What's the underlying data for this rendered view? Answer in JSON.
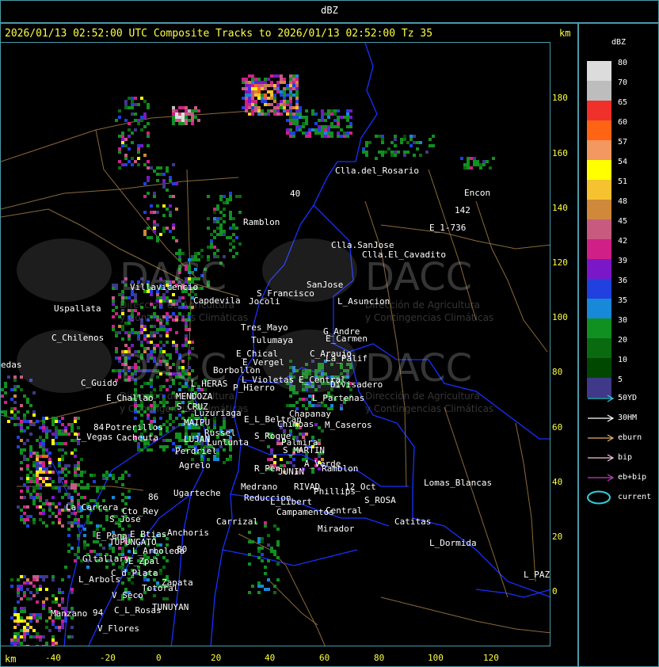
{
  "top_title": "dBZ",
  "header": "2026/01/13 02:52:00 UTC Composite Tracks to 2026/01/13 02:52:00 Tz 35",
  "km_unit": "km",
  "y_ticks": [
    "180",
    "160",
    "140",
    "120",
    "100",
    "80",
    "60",
    "40",
    "20",
    "0"
  ],
  "x_ticks": [
    "-40",
    "-20",
    "0",
    "20",
    "40",
    "60",
    "80",
    "100",
    "120"
  ],
  "legend": {
    "title": "dBZ",
    "levels": [
      {
        "value": "80",
        "color": "#dcdcdc"
      },
      {
        "value": "70",
        "color": "#bdbdbd"
      },
      {
        "value": "65",
        "color": "#f0302a"
      },
      {
        "value": "60",
        "color": "#ff6414"
      },
      {
        "value": "57",
        "color": "#f29860"
      },
      {
        "value": "54",
        "color": "#ffff00"
      },
      {
        "value": "51",
        "color": "#f6c230"
      },
      {
        "value": "48",
        "color": "#d0883a"
      },
      {
        "value": "45",
        "color": "#c85a80"
      },
      {
        "value": "42",
        "color": "#d02088"
      },
      {
        "value": "39",
        "color": "#7a18c8"
      },
      {
        "value": "36",
        "color": "#2040e0"
      },
      {
        "value": "35",
        "color": "#1888d8"
      },
      {
        "value": "30",
        "color": "#109020"
      },
      {
        "value": "20",
        "color": "#0a6a10"
      },
      {
        "value": "10",
        "color": "#004800"
      },
      {
        "value": "5",
        "color": "#403888"
      }
    ],
    "tracks": [
      {
        "label": "50YD",
        "color": "#30d0e0"
      },
      {
        "label": "30HM",
        "color": "#ffffff"
      },
      {
        "label": "eburn",
        "color": "#e0b070"
      },
      {
        "label": "bip",
        "color": "#f0c8e0"
      },
      {
        "label": "eb+bip",
        "color": "#c040c0"
      }
    ],
    "current_label": "current",
    "current_color": "#30d0e0"
  },
  "watermark": {
    "brand": "DACC",
    "line1": "Dirección de Agricultura",
    "line2": "y Contingencias Climáticas"
  },
  "places": [
    "Clla.del_Rosario",
    "Encon",
    "142",
    "E_1-736",
    "Ramblon",
    "Clla.SanJose",
    "Clla.El_Cavadito",
    "S_Francisco",
    "SanJose",
    "L_Asuncion",
    "Villavicencio",
    "Capdevila",
    "Jocoli",
    "Uspallata",
    "Tres_Mayo",
    "Tulumaya",
    "C_Chilenos",
    "G_Andre",
    "E_Carmen",
    "E_Chical",
    "E_Vergel",
    "C_Araujo",
    "La_Palif",
    "edas",
    "Borbollon",
    "L_Violetas",
    "E_Central",
    "Divisadero",
    "C_Guido",
    "E_Challao",
    "L_HERAS",
    "P_Hierro",
    "MENDOZA",
    "L_Partenas",
    "S_CRUZ",
    "Luzuriaga",
    "Chapanay",
    "E_L_Beltran",
    "Chimbas",
    "M_Caseros",
    "Potrerillos",
    "MAIPU",
    "L_Vegas",
    "Cacheuta",
    "Russel",
    "LUJAN",
    "Lunlunta",
    "S_Roque",
    "Palmira",
    "Perdriel",
    "S_MARTIN",
    "A_Verde",
    "Agrelo",
    "Ramblon",
    "R_Pen",
    "JUNIN",
    "Lomas_Blancas",
    "Ugarteche",
    "Medrano",
    "RIVAD",
    "12_Oct",
    "Phillips",
    "Reduccion",
    "S_ROSA",
    "L_Libert",
    "La_Carrera",
    "Cto_Rey",
    "Campamentos",
    "Central",
    "S_Jose",
    "Carrizal",
    "Catitas",
    "Anchoris",
    "Mirador",
    "E_Pena",
    "E_Btias",
    "TUPUNGATO",
    "L_Dormida",
    "L_Arboleda",
    "Gltallary",
    "E_Zpal",
    "C_d_Plata",
    "L_Arbols",
    "Zapata",
    "L_PAZ",
    "V_Seco",
    "Totoral",
    "TUNUYAN",
    "Manzano",
    "C_L_Rosas",
    "V_Flores",
    "84",
    "86",
    "80",
    "94",
    "40"
  ]
}
